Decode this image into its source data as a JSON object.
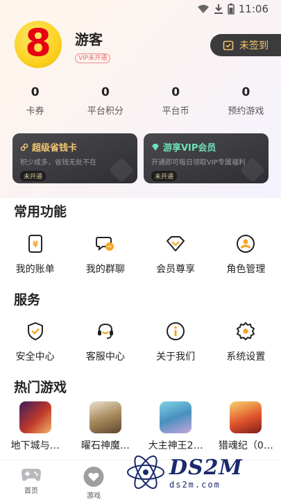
{
  "status_bar": {
    "time": "11:06"
  },
  "profile": {
    "avatar_text": "8",
    "username": "游客",
    "vip_badge": "VIP未开通",
    "signin_label": "未签到"
  },
  "stats": [
    {
      "value": "0",
      "label": "卡券"
    },
    {
      "value": "0",
      "label": "平台积分"
    },
    {
      "value": "0",
      "label": "平台币"
    },
    {
      "value": "0",
      "label": "预约游戏"
    }
  ],
  "cards": [
    {
      "title": "超级省钱卡",
      "desc": "积少成多，省钱无处不在",
      "status": "未开通",
      "accent": "#f6c674"
    },
    {
      "title": "游享VIP会员",
      "desc": "开通即可每日领取VIP专属福利",
      "status": "未开通",
      "accent": "#6fe0b7"
    }
  ],
  "sections": {
    "common": {
      "title": "常用功能",
      "items": [
        {
          "label": "我的账单",
          "icon": "bill-icon"
        },
        {
          "label": "我的群聊",
          "icon": "group-chat-icon"
        },
        {
          "label": "会员尊享",
          "icon": "diamond-icon"
        },
        {
          "label": "角色管理",
          "icon": "user-icon"
        }
      ]
    },
    "service": {
      "title": "服务",
      "items": [
        {
          "label": "安全中心",
          "icon": "shield-icon"
        },
        {
          "label": "客服中心",
          "icon": "headset-icon"
        },
        {
          "label": "关于我们",
          "icon": "info-icon"
        },
        {
          "label": "系统设置",
          "icon": "gear-icon"
        }
      ]
    },
    "hot_games": {
      "title": "热门游戏",
      "items": [
        {
          "name": "地下城与…"
        },
        {
          "name": "曜石神魔…"
        },
        {
          "name": "大主神王2…"
        },
        {
          "name": "猎魂纪（0…"
        }
      ]
    }
  },
  "tabbar": [
    {
      "label": "首页",
      "icon": "gamepad-icon"
    },
    {
      "label": "游戏",
      "icon": "heart-icon"
    }
  ],
  "watermark": {
    "text": "DS2M",
    "sub": "ds2m.com"
  },
  "colors": {
    "accent_orange": "#f5a623",
    "sign_bg": "#3b3b3d",
    "sign_text": "#f5c46a"
  }
}
